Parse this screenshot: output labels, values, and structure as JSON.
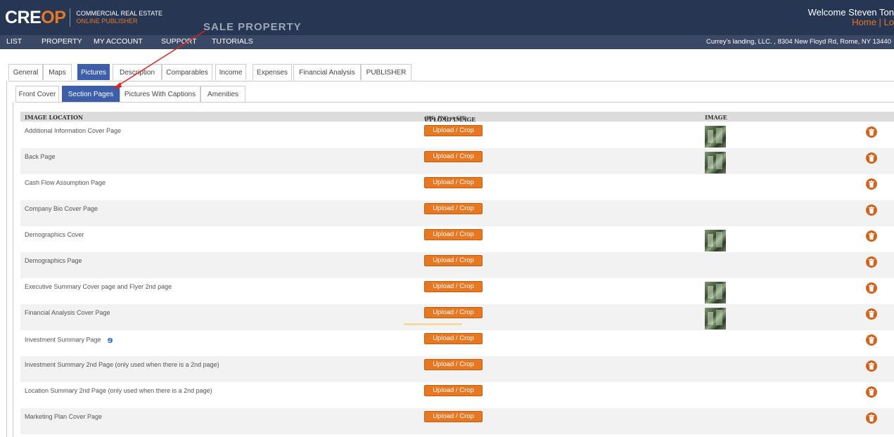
{
  "header": {
    "logo_main": "CRE",
    "logo_accent": "OP",
    "logo_line1": "COMMERCIAL REAL ESTATE",
    "logo_line2": "ONLINE PUBLISHER",
    "section_title": "SALE PROPERTY",
    "welcome": "Welcome Steven Ton",
    "links": "Home |  Lo"
  },
  "nav": {
    "items": [
      "LIST",
      "PROPERTY",
      "MY ACCOUNT",
      "SUPPORT",
      "TUTORIALS"
    ],
    "address": "Currey's landing, LLC. , 8304 New Floyd Rd, Rome, NY 13440"
  },
  "tabs": [
    "General",
    "Maps",
    "Pictures",
    "Description",
    "Comparables",
    "Income",
    "Expenses",
    "Financial Analysis",
    "PUBLISHER"
  ],
  "subtabs": [
    "Front Cover",
    "Section Pages",
    "Pictures With Captions",
    "Amenities"
  ],
  "grid": {
    "col_location": "IMAGE LOCATION",
    "col_upload": "UPLOAD IMAGE",
    "col_upload_note": "(JPG, PNG or GIF)",
    "col_image": "IMAGE",
    "upload_label": "Upload / Crop",
    "rows": [
      {
        "label": "Additional Information Cover Page",
        "has_image": true
      },
      {
        "label": "Back Page",
        "has_image": true
      },
      {
        "label": "Cash Flow Assumption Page",
        "has_image": false
      },
      {
        "label": "Company Bio Cover Page",
        "has_image": false
      },
      {
        "label": "Demographics Cover",
        "has_image": true
      },
      {
        "label": "Demographics Page",
        "has_image": false
      },
      {
        "label": "Executive Summary Cover page and Flyer 2nd page",
        "has_image": true
      },
      {
        "label": "Financial Analysis Cover Page",
        "has_image": true
      },
      {
        "label": "Investment Summary Page",
        "has_image": false
      },
      {
        "label": "Investment Summary 2nd Page (only used when there is a 2nd page)",
        "has_image": false
      },
      {
        "label": "Location Summary 2nd Page (only used when there is a 2nd page)",
        "has_image": false
      },
      {
        "label": "Marketing Plan Cover Page",
        "has_image": false
      }
    ]
  },
  "colors": {
    "topbar": "#273653",
    "navbar": "#3a4865",
    "accent": "#e87722",
    "active_tab": "#3d5ea8",
    "arrow": "#e0221c"
  }
}
